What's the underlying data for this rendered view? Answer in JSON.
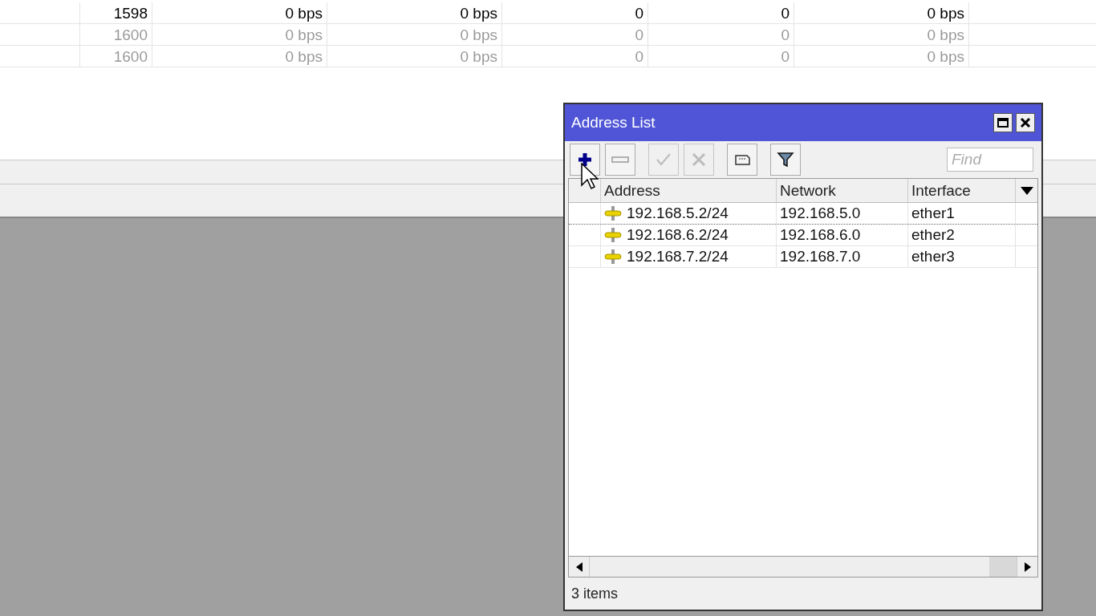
{
  "background_table": {
    "rows": [
      {
        "disabled": false,
        "cells": [
          "1598",
          "0 bps",
          "0 bps",
          "0",
          "0",
          "0 bps"
        ]
      },
      {
        "disabled": true,
        "cells": [
          "1600",
          "0 bps",
          "0 bps",
          "0",
          "0",
          "0 bps"
        ]
      },
      {
        "disabled": true,
        "cells": [
          "1600",
          "0 bps",
          "0 bps",
          "0",
          "0",
          "0 bps"
        ]
      }
    ]
  },
  "window": {
    "title": "Address List",
    "toolbar": [
      {
        "kind": "add",
        "disabled": false
      },
      {
        "kind": "remove",
        "disabled": false
      },
      {
        "kind": "enable",
        "disabled": true
      },
      {
        "kind": "disable",
        "disabled": true
      },
      {
        "kind": "comment",
        "disabled": false
      },
      {
        "kind": "filter",
        "disabled": false
      }
    ],
    "search": {
      "placeholder": "Find"
    },
    "table": {
      "columns": [
        "Address",
        "Network",
        "Interface"
      ],
      "rows": [
        {
          "selected": false,
          "address": "192.168.5.2/24",
          "network": "192.168.5.0",
          "interface": "ether1"
        },
        {
          "selected": false,
          "address": "192.168.6.2/24",
          "network": "192.168.6.0",
          "interface": "ether2"
        },
        {
          "selected": false,
          "address": "192.168.7.2/24",
          "network": "192.168.7.0",
          "interface": "ether3"
        }
      ]
    },
    "status_bar": "3 items"
  }
}
